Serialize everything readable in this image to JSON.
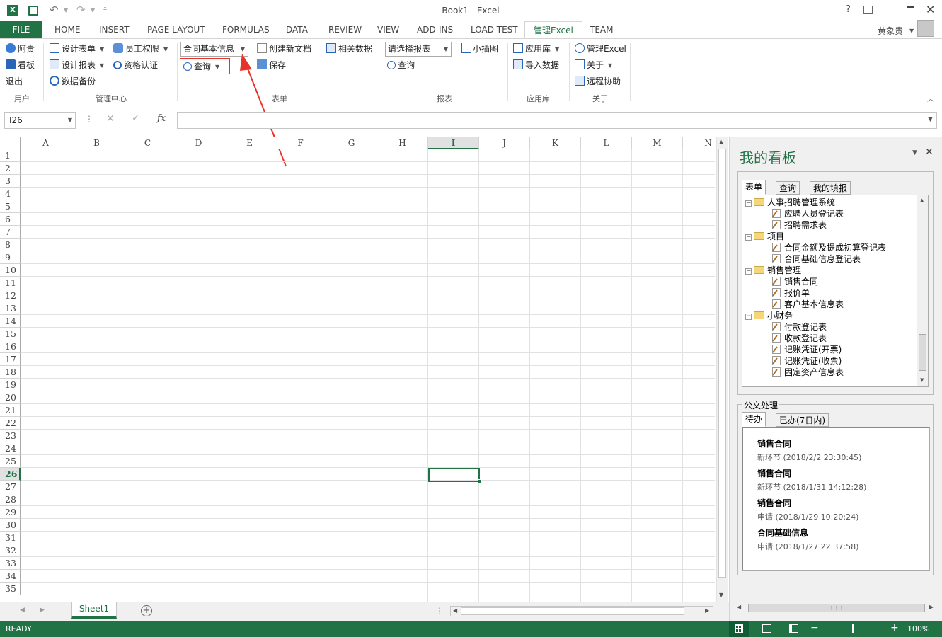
{
  "window": {
    "title": "Book1 - Excel",
    "help": "?",
    "user": "黄象贵"
  },
  "ribbon_tabs": [
    "FILE",
    "HOME",
    "INSERT",
    "PAGE LAYOUT",
    "FORMULAS",
    "DATA",
    "REVIEW",
    "VIEW",
    "ADD-INS",
    "LOAD TEST",
    "管理Excel",
    "TEAM"
  ],
  "ribbon": {
    "user_group": {
      "items": [
        "阿贵",
        "看板",
        "退出"
      ],
      "label": "用户"
    },
    "mgmt_group": {
      "items": [
        "设计表单",
        "设计报表",
        "数据备份",
        "员工权限",
        "资格认证"
      ],
      "label": "管理中心"
    },
    "form_group": {
      "combo": "合同基本信息",
      "query": "查询",
      "new_doc": "创建新文档",
      "save": "保存",
      "label": "表单"
    },
    "related": "相关数据",
    "report_group": {
      "combo": "请选择报表",
      "query": "查询",
      "label": "报表"
    },
    "chart": "小插图",
    "lib_group": {
      "items": [
        "应用库",
        "导入数据"
      ],
      "label": "应用库"
    },
    "about_group": {
      "items": [
        "管理Excel",
        "关于",
        "远程协助"
      ],
      "label": "关于"
    }
  },
  "formula_bar": {
    "name_box": "I26",
    "fx": "fx",
    "formula": ""
  },
  "columns": [
    "A",
    "B",
    "C",
    "D",
    "E",
    "F",
    "G",
    "H",
    "I",
    "J",
    "K",
    "L",
    "M",
    "N"
  ],
  "rows": [
    "1",
    "2",
    "3",
    "4",
    "5",
    "6",
    "7",
    "8",
    "9",
    "10",
    "11",
    "12",
    "13",
    "14",
    "15",
    "16",
    "17",
    "18",
    "19",
    "20",
    "21",
    "22",
    "23",
    "24",
    "25",
    "26",
    "27",
    "28",
    "29",
    "30",
    "31",
    "32",
    "33",
    "34",
    "35"
  ],
  "active_cell": {
    "col": "I",
    "row": "26"
  },
  "sheet_tabs": [
    "Sheet1"
  ],
  "status": {
    "ready": "READY",
    "zoom": "100%"
  },
  "pane": {
    "title": "我的看板",
    "tabs": [
      "表单",
      "查询",
      "我的填报"
    ],
    "tree": [
      {
        "folder": "人事招聘管理系统",
        "items": [
          "应聘人员登记表",
          "招聘需求表"
        ]
      },
      {
        "folder": "项目",
        "items": [
          "合同金额及提成初算登记表",
          "合同基础信息登记表"
        ]
      },
      {
        "folder": "销售管理",
        "items": [
          "销售合同",
          "报价单",
          "客户基本信息表"
        ]
      },
      {
        "folder": "小财务",
        "items": [
          "付款登记表",
          "收款登记表",
          "记账凭证(开票)",
          "记账凭证(收票)",
          "固定资产信息表"
        ]
      }
    ],
    "doc_section": "公文处理",
    "doc_tabs": [
      "待办",
      "已办(7日内)"
    ],
    "todos": [
      {
        "title": "销售合同",
        "sub": "新环节 (2018/2/2 23:30:45)"
      },
      {
        "title": "销售合同",
        "sub": "新环节 (2018/1/31 14:12:28)"
      },
      {
        "title": "销售合同",
        "sub": "申请 (2018/1/29 10:20:24)"
      },
      {
        "title": "合同基础信息",
        "sub": "申请 (2018/1/27 22:37:58)"
      }
    ]
  },
  "colors": {
    "excel_green": "#217346",
    "annotation_red": "#e8332a"
  }
}
